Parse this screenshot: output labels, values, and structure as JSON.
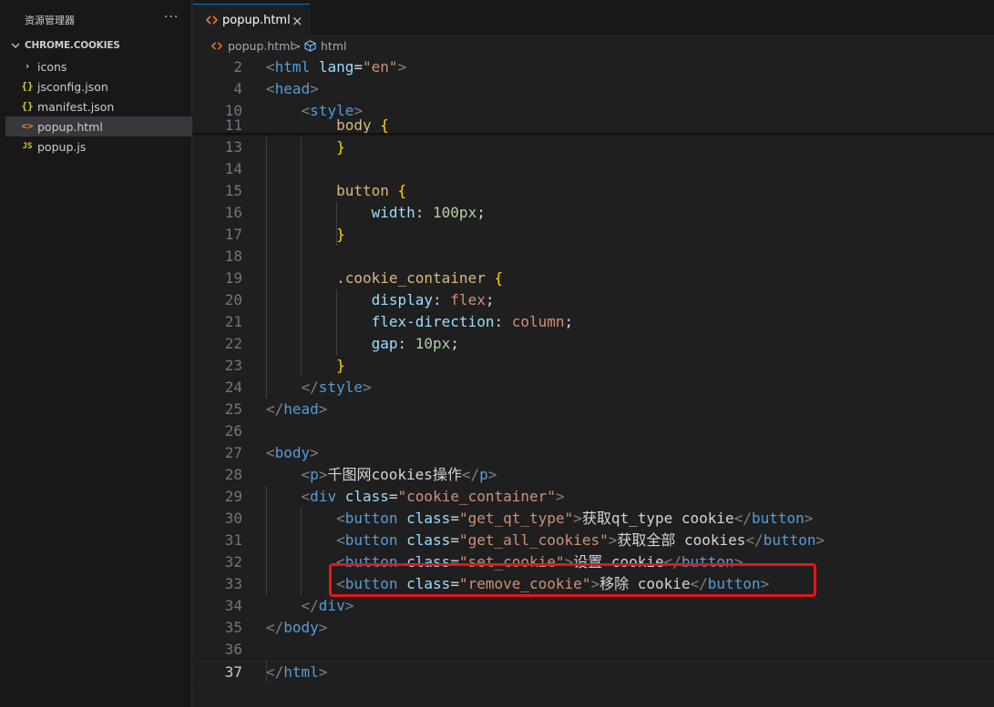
{
  "explorer": {
    "title": "资源管理器",
    "more": "···",
    "folder": "CHROME.COOKIES",
    "items": [
      {
        "label": "icons",
        "icon": "›",
        "kind": "folder"
      },
      {
        "label": "jsconfig.json",
        "icon": "{}",
        "kind": "json"
      },
      {
        "label": "manifest.json",
        "icon": "{}",
        "kind": "json"
      },
      {
        "label": "popup.html",
        "icon": "<>",
        "kind": "html",
        "selected": true
      },
      {
        "label": "popup.js",
        "icon": "JS",
        "kind": "js"
      }
    ]
  },
  "tabs": [
    {
      "label": "popup.html",
      "icon": "html-file-icon",
      "active": true,
      "close": "×"
    }
  ],
  "breadcrumb": {
    "file": "popup.html",
    "separator": ">",
    "symbol": "html"
  },
  "editor": {
    "current_line": "37",
    "lines": [
      {
        "n": "2",
        "tokens": [
          [
            "pn",
            "<"
          ],
          [
            "tg",
            "html"
          ],
          [
            "tx",
            " "
          ],
          [
            "at",
            "lang"
          ],
          [
            "tx",
            "="
          ],
          [
            "st",
            "\"en\""
          ],
          [
            "pn",
            ">"
          ]
        ]
      },
      {
        "n": "4",
        "tokens": [
          [
            "pn",
            "<"
          ],
          [
            "tg",
            "head"
          ],
          [
            "pn",
            ">"
          ]
        ]
      },
      {
        "n": "10",
        "tokens": [
          [
            "tx",
            "    "
          ],
          [
            "pn",
            "<"
          ],
          [
            "tg",
            "style"
          ],
          [
            "pn",
            ">"
          ]
        ]
      },
      {
        "n": "11",
        "tokens": [
          [
            "tx",
            "        "
          ],
          [
            "sel",
            "body"
          ],
          [
            "tx",
            " "
          ],
          [
            "br",
            "{"
          ]
        ]
      },
      {
        "n": "13",
        "tokens": [
          [
            "tx",
            "        "
          ],
          [
            "br",
            "}"
          ]
        ]
      },
      {
        "n": "14",
        "tokens": []
      },
      {
        "n": "15",
        "tokens": [
          [
            "tx",
            "        "
          ],
          [
            "sel",
            "button"
          ],
          [
            "tx",
            " "
          ],
          [
            "br",
            "{"
          ]
        ]
      },
      {
        "n": "16",
        "tokens": [
          [
            "tx",
            "            "
          ],
          [
            "pr",
            "width"
          ],
          [
            "tx",
            ": "
          ],
          [
            "nm",
            "100px"
          ],
          [
            "tx",
            ";"
          ]
        ]
      },
      {
        "n": "17",
        "tokens": [
          [
            "tx",
            "        "
          ],
          [
            "br",
            "}"
          ]
        ]
      },
      {
        "n": "18",
        "tokens": []
      },
      {
        "n": "19",
        "tokens": [
          [
            "tx",
            "        "
          ],
          [
            "sel",
            ".cookie_container"
          ],
          [
            "tx",
            " "
          ],
          [
            "br",
            "{"
          ]
        ]
      },
      {
        "n": "20",
        "tokens": [
          [
            "tx",
            "            "
          ],
          [
            "pr",
            "display"
          ],
          [
            "tx",
            ": "
          ],
          [
            "vl",
            "flex"
          ],
          [
            "tx",
            ";"
          ]
        ]
      },
      {
        "n": "21",
        "tokens": [
          [
            "tx",
            "            "
          ],
          [
            "pr",
            "flex-direction"
          ],
          [
            "tx",
            ": "
          ],
          [
            "vl",
            "column"
          ],
          [
            "tx",
            ";"
          ]
        ]
      },
      {
        "n": "22",
        "tokens": [
          [
            "tx",
            "            "
          ],
          [
            "pr",
            "gap"
          ],
          [
            "tx",
            ": "
          ],
          [
            "nm",
            "10px"
          ],
          [
            "tx",
            ";"
          ]
        ]
      },
      {
        "n": "23",
        "tokens": [
          [
            "tx",
            "        "
          ],
          [
            "br",
            "}"
          ]
        ]
      },
      {
        "n": "24",
        "tokens": [
          [
            "tx",
            "    "
          ],
          [
            "pn",
            "</"
          ],
          [
            "tg",
            "style"
          ],
          [
            "pn",
            ">"
          ]
        ]
      },
      {
        "n": "25",
        "tokens": [
          [
            "pn",
            "</"
          ],
          [
            "tg",
            "head"
          ],
          [
            "pn",
            ">"
          ]
        ]
      },
      {
        "n": "26",
        "tokens": []
      },
      {
        "n": "27",
        "tokens": [
          [
            "pn",
            "<"
          ],
          [
            "tg",
            "body"
          ],
          [
            "pn",
            ">"
          ]
        ]
      },
      {
        "n": "28",
        "tokens": [
          [
            "tx",
            "    "
          ],
          [
            "pn",
            "<"
          ],
          [
            "tg",
            "p"
          ],
          [
            "pn",
            ">"
          ],
          [
            "tx",
            "千图网cookies操作"
          ],
          [
            "pn",
            "</"
          ],
          [
            "tg",
            "p"
          ],
          [
            "pn",
            ">"
          ]
        ]
      },
      {
        "n": "29",
        "tokens": [
          [
            "tx",
            "    "
          ],
          [
            "pn",
            "<"
          ],
          [
            "tg",
            "div"
          ],
          [
            "tx",
            " "
          ],
          [
            "at",
            "class"
          ],
          [
            "tx",
            "="
          ],
          [
            "st",
            "\"cookie_container\""
          ],
          [
            "pn",
            ">"
          ]
        ]
      },
      {
        "n": "30",
        "tokens": [
          [
            "tx",
            "        "
          ],
          [
            "pn",
            "<"
          ],
          [
            "tg",
            "button"
          ],
          [
            "tx",
            " "
          ],
          [
            "at",
            "class"
          ],
          [
            "tx",
            "="
          ],
          [
            "st",
            "\"get_qt_type\""
          ],
          [
            "pn",
            ">"
          ],
          [
            "tx",
            "获取qt_type cookie"
          ],
          [
            "pn",
            "</"
          ],
          [
            "tg",
            "button"
          ],
          [
            "pn",
            ">"
          ]
        ]
      },
      {
        "n": "31",
        "tokens": [
          [
            "tx",
            "        "
          ],
          [
            "pn",
            "<"
          ],
          [
            "tg",
            "button"
          ],
          [
            "tx",
            " "
          ],
          [
            "at",
            "class"
          ],
          [
            "tx",
            "="
          ],
          [
            "st",
            "\"get_all_cookies\""
          ],
          [
            "pn",
            ">"
          ],
          [
            "tx",
            "获取全部 cookies"
          ],
          [
            "pn",
            "</"
          ],
          [
            "tg",
            "button"
          ],
          [
            "pn",
            ">"
          ]
        ]
      },
      {
        "n": "32",
        "tokens": [
          [
            "tx",
            "        "
          ],
          [
            "pn",
            "<"
          ],
          [
            "tg",
            "button"
          ],
          [
            "tx",
            " "
          ],
          [
            "at",
            "class"
          ],
          [
            "tx",
            "="
          ],
          [
            "st",
            "\"set_cookie\""
          ],
          [
            "pn",
            ">"
          ],
          [
            "tx",
            "设置 cookie"
          ],
          [
            "pn",
            "</"
          ],
          [
            "tg",
            "button"
          ],
          [
            "pn",
            ">"
          ]
        ]
      },
      {
        "n": "33",
        "tokens": [
          [
            "tx",
            "        "
          ],
          [
            "pn",
            "<"
          ],
          [
            "tg",
            "button"
          ],
          [
            "tx",
            " "
          ],
          [
            "at",
            "class"
          ],
          [
            "tx",
            "="
          ],
          [
            "st",
            "\"remove_cookie\""
          ],
          [
            "pn",
            ">"
          ],
          [
            "tx",
            "移除 cookie"
          ],
          [
            "pn",
            "</"
          ],
          [
            "tg",
            "button"
          ],
          [
            "pn",
            ">"
          ]
        ]
      },
      {
        "n": "34",
        "tokens": [
          [
            "tx",
            "    "
          ],
          [
            "pn",
            "</"
          ],
          [
            "tg",
            "div"
          ],
          [
            "pn",
            ">"
          ]
        ]
      },
      {
        "n": "35",
        "tokens": [
          [
            "pn",
            "</"
          ],
          [
            "tg",
            "body"
          ],
          [
            "pn",
            ">"
          ]
        ]
      },
      {
        "n": "36",
        "tokens": []
      },
      {
        "n": "37",
        "tokens": [
          [
            "pn",
            "</"
          ],
          [
            "tg",
            "html"
          ],
          [
            "pn",
            ">"
          ]
        ]
      }
    ]
  },
  "colors": {
    "accent": "#0078d4",
    "highlight_box": "#e8141b",
    "editor_bg": "#1f1f1f",
    "sidebar_bg": "#181818"
  }
}
